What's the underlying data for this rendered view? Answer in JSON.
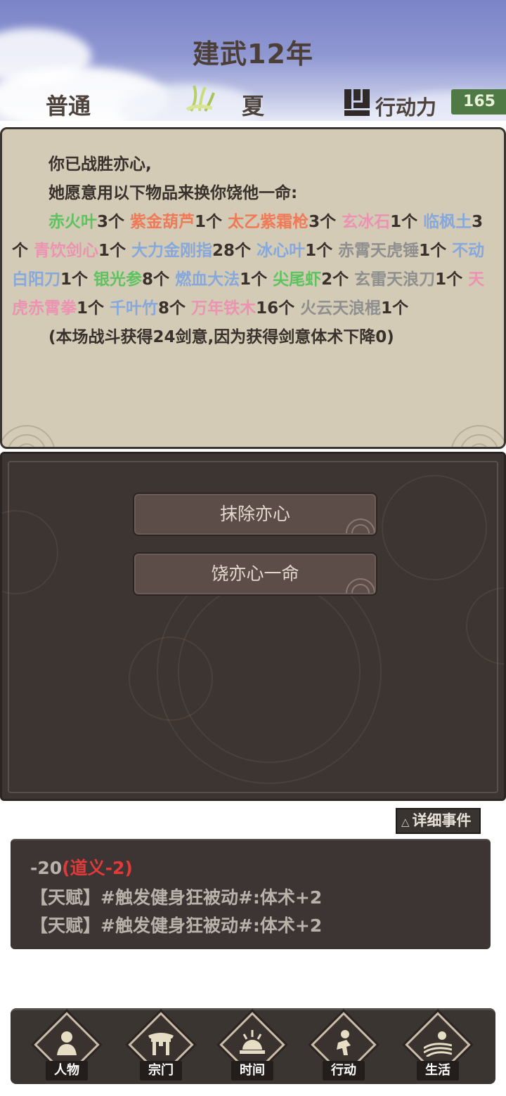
{
  "header": {
    "title": "建武12年",
    "difficulty": "普通",
    "season": "夏",
    "action_points_label": "行动力",
    "action_points_value": "165"
  },
  "message": {
    "line1": "你已战胜亦心,",
    "line2": "她愿意用以下物品来换你饶他一命:",
    "items": [
      {
        "name": "赤火叶",
        "qty": "3个",
        "color": "#5dc35e"
      },
      {
        "name": "紫金葫芦",
        "qty": "1个",
        "color": "#ef7a58"
      },
      {
        "name": "太乙紫霜枪",
        "qty": "3个",
        "color": "#ef7a58"
      },
      {
        "name": "玄冰石",
        "qty": "1个",
        "color": "#ec93b2"
      },
      {
        "name": "临枫土",
        "qty": "3个",
        "color": "#86a8dc"
      },
      {
        "name": "青饮剑心",
        "qty": "1个",
        "color": "#ec93b2"
      },
      {
        "name": "大力金刚指",
        "qty": "28个",
        "color": "#86a8dc"
      },
      {
        "name": "冰心叶",
        "qty": "1个",
        "color": "#86a8dc"
      },
      {
        "name": "赤霄天虎锤",
        "qty": "1个",
        "color": "#8f8f8f"
      },
      {
        "name": "不动白阳刀",
        "qty": "1个",
        "color": "#86a8dc"
      },
      {
        "name": "银光参",
        "qty": "8个",
        "color": "#5dc35e"
      },
      {
        "name": "燃血大法",
        "qty": "1个",
        "color": "#86a8dc"
      },
      {
        "name": "尖尾虾",
        "qty": "2个",
        "color": "#5dc35e"
      },
      {
        "name": "玄雷天浪刀",
        "qty": "1个",
        "color": "#8f8f8f"
      },
      {
        "name": "天虎赤霄拳",
        "qty": "1个",
        "color": "#ec93b2"
      },
      {
        "name": "千叶竹",
        "qty": "8个",
        "color": "#86a8dc"
      },
      {
        "name": "万年铁木",
        "qty": "16个",
        "color": "#ec93b2"
      },
      {
        "name": "火云天浪棍",
        "qty": "1个",
        "color": "#8f8f8f"
      }
    ],
    "footer": "(本场战斗获得24剑意,因为获得剑意体术下降0)"
  },
  "choices": {
    "erase": "抹除亦心",
    "spare": "饶亦心一命"
  },
  "details_button": "详细事件",
  "log": {
    "line1_prefix": "-20",
    "line1_red": "(道义-2)",
    "line2": "【天赋】#触发健身狂被动#:体术+2",
    "line3": "【天赋】#触发健身狂被动#:体术+2"
  },
  "nav": {
    "character": "人物",
    "sect": "宗门",
    "time": "时间",
    "action": "行动",
    "life": "生活"
  }
}
